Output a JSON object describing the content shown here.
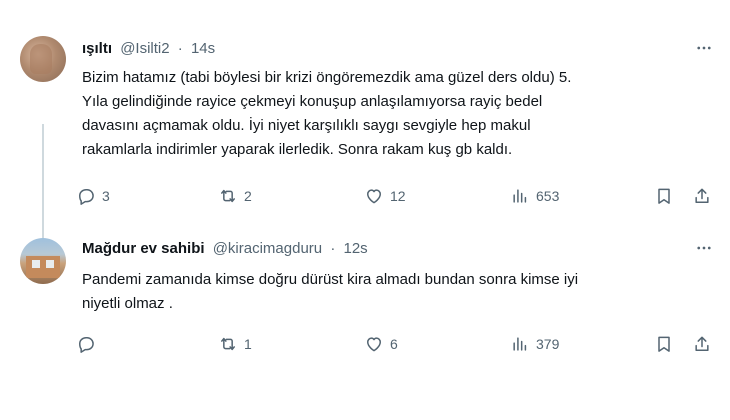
{
  "tweets": [
    {
      "display_name": "ışıltı",
      "handle": "@Isilti2",
      "separator": "·",
      "time": "14s",
      "text": "Bizim hatamız (tabi böylesi bir krizi öngöremezdik ama güzel ders oldu) 5.\nYıla gelindiğinde rayice çekmeyi konuşup anlaşılamıyorsa rayiç bedel\ndavasını açmamak oldu. İyi niyet karşılıklı saygı sevgiyle hep makul\nrakamlarla indirimler yaparak ilerledik. Sonra rakam kuş gb kaldı.",
      "replies": "3",
      "retweets": "2",
      "likes": "12",
      "views": "653"
    },
    {
      "display_name": "Mağdur ev sahibi",
      "handle": "@kiracimagduru",
      "separator": "·",
      "time": "12s",
      "text": "Pandemi zamanıda kimse doğru dürüst kira almadı bundan sonra kimse iyi\nniyetli olmaz .",
      "replies": "",
      "retweets": "1",
      "likes": "6",
      "views": "379"
    }
  ],
  "icons": {
    "more": "more-dots-icon",
    "reply": "reply-icon",
    "retweet": "retweet-icon",
    "like": "heart-icon",
    "views": "views-icon",
    "bookmark": "bookmark-icon",
    "share": "share-icon"
  },
  "colors": {
    "text_primary": "#0f1419",
    "text_secondary": "#536471",
    "thread_line": "#cfd9de"
  }
}
